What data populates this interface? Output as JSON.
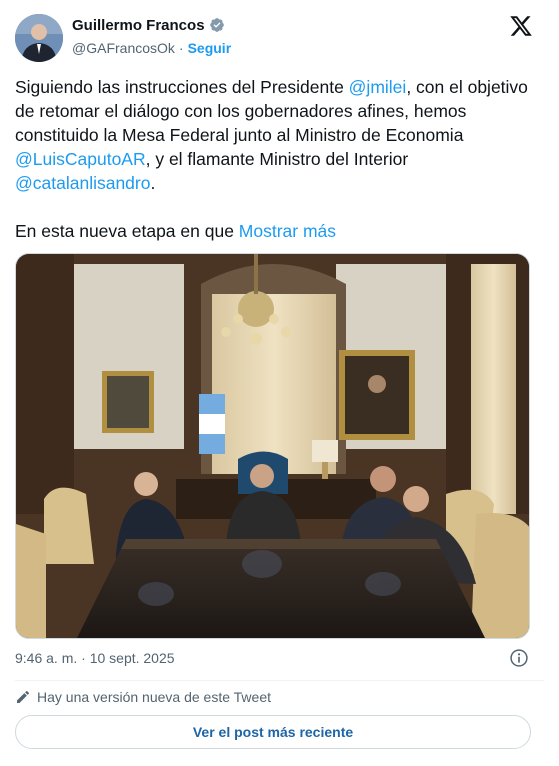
{
  "author": {
    "name": "Guillermo Francos",
    "handle": "@GAFrancosOk",
    "separator": "·",
    "follow_label": "Seguir",
    "verified": true
  },
  "tweet": {
    "p1": [
      {
        "type": "text",
        "value": "Siguiendo las instrucciones del Presidente "
      },
      {
        "type": "mention",
        "value": "@jmilei"
      },
      {
        "type": "text",
        "value": ", con el objetivo de retomar el diálogo con los gobernadores afines, hemos constituido la Mesa Federal junto al Ministro de Economia "
      },
      {
        "type": "mention",
        "value": "@LuisCaputoAR"
      },
      {
        "type": "text",
        "value": ", y el flamante Ministro del Interior "
      },
      {
        "type": "mention",
        "value": "@catalanlisandro"
      },
      {
        "type": "text",
        "value": "."
      }
    ],
    "p2_text": "En esta nueva etapa en que ",
    "show_more": "Mostrar más"
  },
  "media": {
    "icon": "photo-meeting"
  },
  "timestamp": "9:46 a. m. · 10 sept. 2025",
  "notice": {
    "icon": "pencil-icon",
    "text": "Hay una versión nueva de este Tweet"
  },
  "cta_label": "Ver el post más reciente",
  "colors": {
    "accent": "#1d9bf0",
    "text": "#0f1419",
    "muted": "#536471",
    "border": "#cfd9de"
  }
}
